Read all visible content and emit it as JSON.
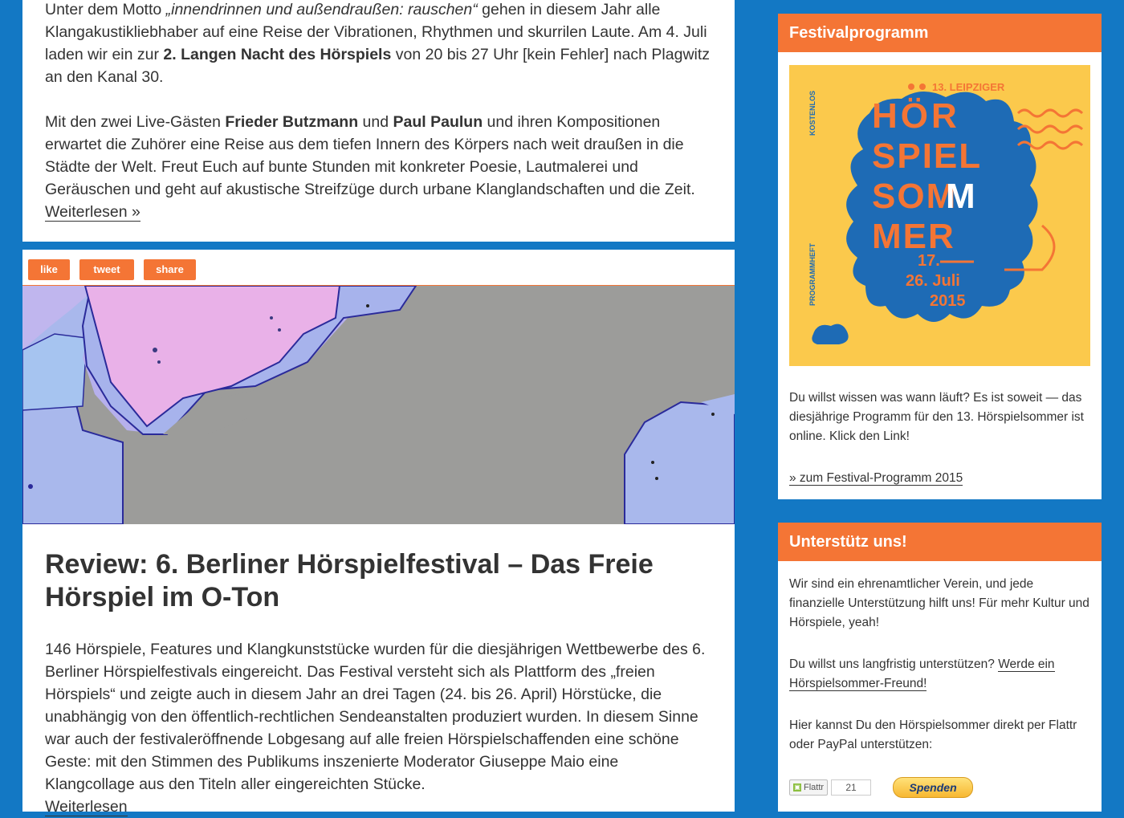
{
  "post1": {
    "p1": [
      {
        "t": "Unter dem Motto "
      },
      {
        "t": "„innendrinnen und außendraußen: rauschen“",
        "s": "i"
      },
      {
        "t": " gehen in diesem Jahr alle Klangakustikliebhaber auf eine Reise der Vibrationen, Rhythmen und skurrilen Laute. Am 4. Juli laden wir ein zur "
      },
      {
        "t": "2. Langen Nacht des Hörspiels",
        "s": "b"
      },
      {
        "t": " von 20 bis 27 Uhr [kein Fehler] nach Plagwitz an den Kanal 30."
      }
    ],
    "p2": [
      {
        "t": "Mit den zwei Live-Gästen "
      },
      {
        "t": "Frieder Butzmann",
        "s": "b"
      },
      {
        "t": " und "
      },
      {
        "t": "Paul Paulun",
        "s": "b"
      },
      {
        "t": " und ihren Kompositionen erwartet die Zuhörer eine Reise aus dem tiefen Innern des Körpers nach weit draußen in die Städte der Welt. Freut Euch auf bunte Stunden mit konkreter Poesie, Lautmalerei und Geräuschen und geht auf akustische Streifzüge durch urbane Klanglandschaften und die Zeit. "
      }
    ],
    "readmore": "Weiterlesen »"
  },
  "share": {
    "like": "like",
    "tweet": "tweet",
    "share": "share"
  },
  "post2": {
    "title": "Review: 6. Berliner Hörspielfestival – Das Freie Hörspiel im O-Ton",
    "excerpt": "146 Hörspiele, Features und Klangkunststücke wurden für die diesjährigen Wettbewerbe des 6. Berliner Hörspielfestivals eingereicht. Das Festival versteht sich als Plattform des „freien Hörspiels“ und zeigte auch in diesem Jahr an drei Tagen (24. bis 26. April) Hörstücke, die unabhängig von den öffentlich-rechtlichen Sendeanstalten produziert wurden. In diesem Sinne war auch der festivaleröffnende Lobgesang auf alle freien Hörspielschaffenden eine schöne Geste: mit den Stimmen des Publikums inszenierte Moderator Giuseppe Maio eine Klangcollage aus den Titeln aller eingereichten Stücke.",
    "readmore": "Weiterlesen"
  },
  "widget1": {
    "title": "Festivalprogramm",
    "poster": {
      "subtitle": "13. LEIPZIGER",
      "word1": "HÖR",
      "word2": "SPIEL",
      "word3": "SOM",
      "word3b": "M",
      "word4": "MER",
      "side1": "KOSTENLOS",
      "side2": "PROGRAMMHEFT",
      "date1": "17.",
      "date2": "26. Juli",
      "year": "2015"
    },
    "text": "Du willst wissen was wann läuft? Es ist soweit — das diesjährige Programm für den 13. Hörspielsommer ist online. Klick den Link!",
    "link": "» zum Festival-Programm 2015"
  },
  "widget2": {
    "title": "Unterstütz uns!",
    "p1": "Wir sind ein ehrenamtlicher Verein, und jede finanzielle Unterstützung hilft uns! Für mehr Kultur und Hörspiele, yeah!",
    "p2_text": "Du willst uns langfristig unterstützen? ",
    "p2_link": "Werde ein Hörspielsommer-Freund!",
    "p3": "Hier kannst Du den Hörspielsommer direkt per Flattr oder PayPal unterstützen:",
    "flattr_label": "Flattr",
    "flattr_count": "21",
    "paypal_label": "Spenden"
  },
  "colors": {
    "accent": "#f47535",
    "background": "#1378c4",
    "poster_yellow": "#fbc94c",
    "poster_blue": "#1e6bb5"
  }
}
